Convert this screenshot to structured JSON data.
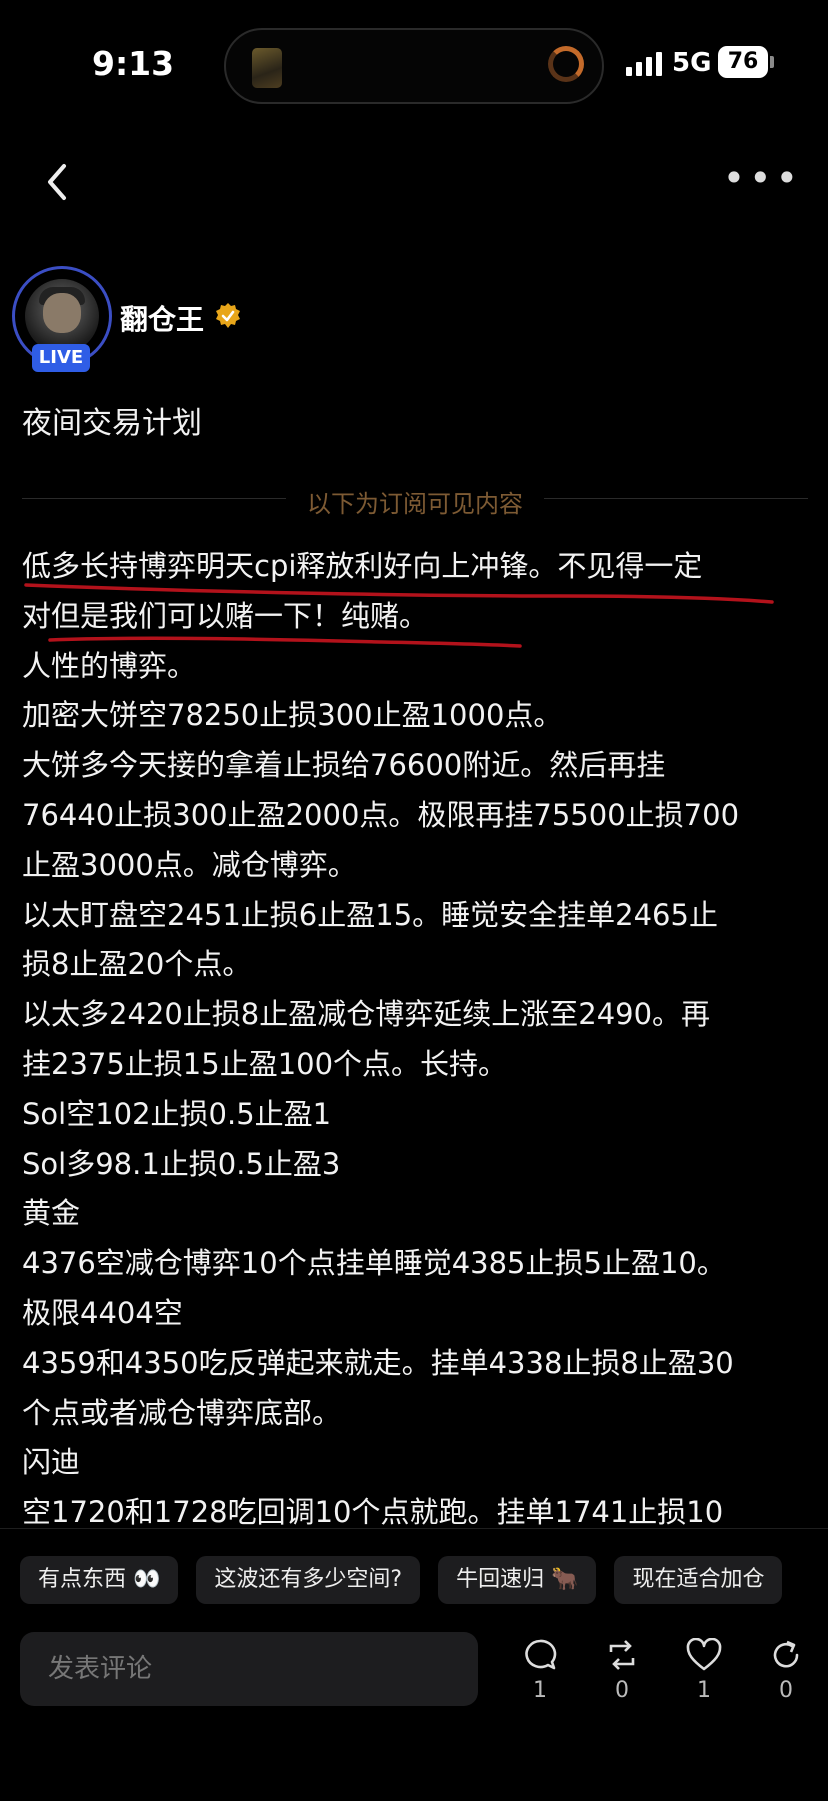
{
  "status_bar": {
    "time": "9:13",
    "network": "5G",
    "battery": "76"
  },
  "author": {
    "name": "翻仓王",
    "live_badge": "LIVE"
  },
  "post": {
    "title": "夜间交易计划",
    "divider_label": "以下为订阅可见内容",
    "lines": [
      "低多长持博弈明天cpi释放利好向上冲锋。不见得一定",
      "对但是我们可以赌一下！纯赌。",
      "人性的博弈。",
      "加密大饼空78250止损300止盈1000点。",
      "大饼多今天接的拿着止损给76600附近。然后再挂",
      "76440止损300止盈2000点。极限再挂75500止损700",
      "止盈3000点。减仓博弈。",
      "以太盯盘空2451止损6止盈15。睡觉安全挂单2465止",
      "损8止盈20个点。",
      "以太多2420止损8止盈减仓博弈延续上涨至2490。再",
      "挂2375止损15止盈100个点。长持。",
      "Sol空102止损0.5止盈1",
      "Sol多98.1止损0.5止盈3",
      "黄金",
      "4376空减仓博弈10个点挂单睡觉4385止损5止盈10。",
      "极限4404空",
      "4359和4350吃反弹起来就走。挂单4338止损8止盈30",
      "个点或者减仓博弈底部。",
      "闪迪",
      "空1720和1728吃回调10个点就跑。挂单1741止损10"
    ]
  },
  "quick_replies": [
    "有点东西 👀",
    "这波还有多少空间?",
    "牛回速归 🐂",
    "现在适合加仓"
  ],
  "comment": {
    "placeholder": "发表评论"
  },
  "actions": {
    "comment_count": "1",
    "repost_count": "0",
    "like_count": "1",
    "share_count": "0"
  },
  "colors": {
    "background": "#000000",
    "accent_live": "#2f5de6",
    "underline": "#b3121b",
    "divider_text": "#7d5a33"
  }
}
